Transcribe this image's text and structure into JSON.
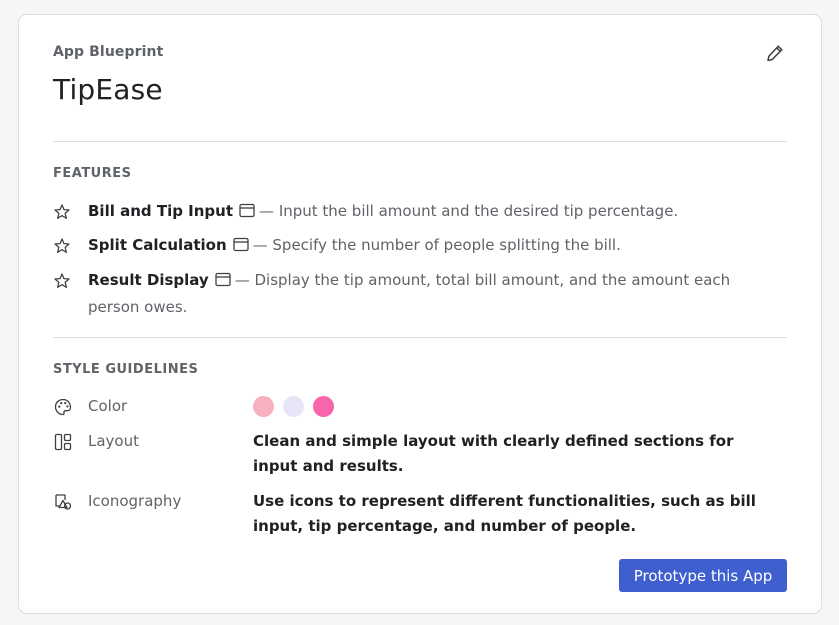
{
  "header": {
    "label": "App Blueprint",
    "app_name": "TipEase",
    "edit_icon": "pencil-icon"
  },
  "features": {
    "heading": "FEATURES",
    "items": [
      {
        "icon": "star-icon",
        "name": "Bill and Tip Input",
        "separator": "—",
        "description": "Input the bill amount and the desired tip percentage."
      },
      {
        "icon": "star-icon",
        "name": "Split Calculation",
        "separator": "—",
        "description": "Specify the number of people splitting the bill."
      },
      {
        "icon": "star-icon",
        "name": "Result Display",
        "separator": "—",
        "description": "Display the tip amount, total bill amount, and the amount each person owes."
      }
    ]
  },
  "style_guidelines": {
    "heading": "STYLE GUIDELINES",
    "color": {
      "label": "Color",
      "icon": "palette-icon",
      "swatches": [
        "#f8afbe",
        "#e7e6f8",
        "#f765ab"
      ]
    },
    "layout": {
      "label": "Layout",
      "icon": "layout-icon",
      "value": "Clean and simple layout with clearly defined sections for input and results."
    },
    "iconography": {
      "label": "Iconography",
      "icon": "shapes-icon",
      "value": "Use icons to represent different functionalities, such as bill input, tip percentage, and number of people."
    }
  },
  "actions": {
    "prototype_label": "Prototype this App",
    "accent": "#3f5fcf"
  }
}
